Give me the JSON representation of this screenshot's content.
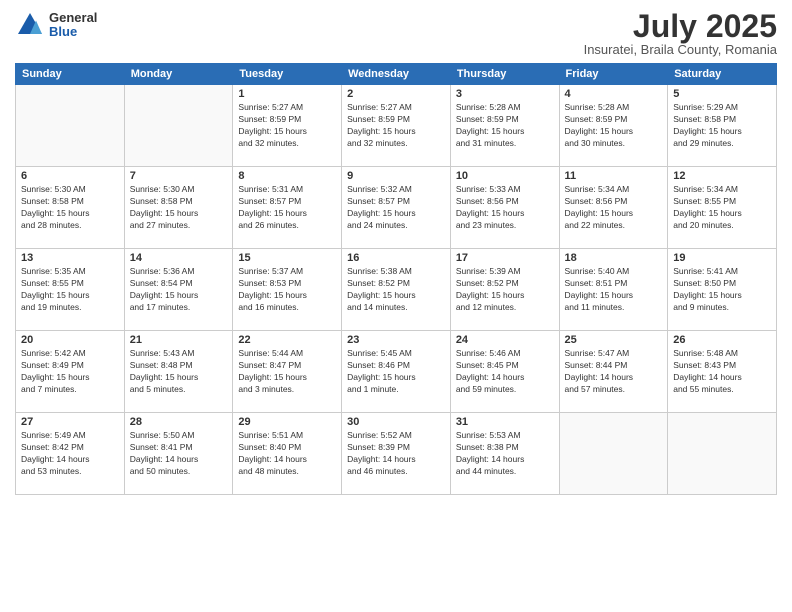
{
  "header": {
    "logo": {
      "general": "General",
      "blue": "Blue"
    },
    "title": "July 2025",
    "location": "Insuratei, Braila County, Romania"
  },
  "calendar": {
    "weekdays": [
      "Sunday",
      "Monday",
      "Tuesday",
      "Wednesday",
      "Thursday",
      "Friday",
      "Saturday"
    ],
    "weeks": [
      [
        {
          "day": "",
          "detail": ""
        },
        {
          "day": "",
          "detail": ""
        },
        {
          "day": "1",
          "detail": "Sunrise: 5:27 AM\nSunset: 8:59 PM\nDaylight: 15 hours\nand 32 minutes."
        },
        {
          "day": "2",
          "detail": "Sunrise: 5:27 AM\nSunset: 8:59 PM\nDaylight: 15 hours\nand 32 minutes."
        },
        {
          "day": "3",
          "detail": "Sunrise: 5:28 AM\nSunset: 8:59 PM\nDaylight: 15 hours\nand 31 minutes."
        },
        {
          "day": "4",
          "detail": "Sunrise: 5:28 AM\nSunset: 8:59 PM\nDaylight: 15 hours\nand 30 minutes."
        },
        {
          "day": "5",
          "detail": "Sunrise: 5:29 AM\nSunset: 8:58 PM\nDaylight: 15 hours\nand 29 minutes."
        }
      ],
      [
        {
          "day": "6",
          "detail": "Sunrise: 5:30 AM\nSunset: 8:58 PM\nDaylight: 15 hours\nand 28 minutes."
        },
        {
          "day": "7",
          "detail": "Sunrise: 5:30 AM\nSunset: 8:58 PM\nDaylight: 15 hours\nand 27 minutes."
        },
        {
          "day": "8",
          "detail": "Sunrise: 5:31 AM\nSunset: 8:57 PM\nDaylight: 15 hours\nand 26 minutes."
        },
        {
          "day": "9",
          "detail": "Sunrise: 5:32 AM\nSunset: 8:57 PM\nDaylight: 15 hours\nand 24 minutes."
        },
        {
          "day": "10",
          "detail": "Sunrise: 5:33 AM\nSunset: 8:56 PM\nDaylight: 15 hours\nand 23 minutes."
        },
        {
          "day": "11",
          "detail": "Sunrise: 5:34 AM\nSunset: 8:56 PM\nDaylight: 15 hours\nand 22 minutes."
        },
        {
          "day": "12",
          "detail": "Sunrise: 5:34 AM\nSunset: 8:55 PM\nDaylight: 15 hours\nand 20 minutes."
        }
      ],
      [
        {
          "day": "13",
          "detail": "Sunrise: 5:35 AM\nSunset: 8:55 PM\nDaylight: 15 hours\nand 19 minutes."
        },
        {
          "day": "14",
          "detail": "Sunrise: 5:36 AM\nSunset: 8:54 PM\nDaylight: 15 hours\nand 17 minutes."
        },
        {
          "day": "15",
          "detail": "Sunrise: 5:37 AM\nSunset: 8:53 PM\nDaylight: 15 hours\nand 16 minutes."
        },
        {
          "day": "16",
          "detail": "Sunrise: 5:38 AM\nSunset: 8:52 PM\nDaylight: 15 hours\nand 14 minutes."
        },
        {
          "day": "17",
          "detail": "Sunrise: 5:39 AM\nSunset: 8:52 PM\nDaylight: 15 hours\nand 12 minutes."
        },
        {
          "day": "18",
          "detail": "Sunrise: 5:40 AM\nSunset: 8:51 PM\nDaylight: 15 hours\nand 11 minutes."
        },
        {
          "day": "19",
          "detail": "Sunrise: 5:41 AM\nSunset: 8:50 PM\nDaylight: 15 hours\nand 9 minutes."
        }
      ],
      [
        {
          "day": "20",
          "detail": "Sunrise: 5:42 AM\nSunset: 8:49 PM\nDaylight: 15 hours\nand 7 minutes."
        },
        {
          "day": "21",
          "detail": "Sunrise: 5:43 AM\nSunset: 8:48 PM\nDaylight: 15 hours\nand 5 minutes."
        },
        {
          "day": "22",
          "detail": "Sunrise: 5:44 AM\nSunset: 8:47 PM\nDaylight: 15 hours\nand 3 minutes."
        },
        {
          "day": "23",
          "detail": "Sunrise: 5:45 AM\nSunset: 8:46 PM\nDaylight: 15 hours\nand 1 minute."
        },
        {
          "day": "24",
          "detail": "Sunrise: 5:46 AM\nSunset: 8:45 PM\nDaylight: 14 hours\nand 59 minutes."
        },
        {
          "day": "25",
          "detail": "Sunrise: 5:47 AM\nSunset: 8:44 PM\nDaylight: 14 hours\nand 57 minutes."
        },
        {
          "day": "26",
          "detail": "Sunrise: 5:48 AM\nSunset: 8:43 PM\nDaylight: 14 hours\nand 55 minutes."
        }
      ],
      [
        {
          "day": "27",
          "detail": "Sunrise: 5:49 AM\nSunset: 8:42 PM\nDaylight: 14 hours\nand 53 minutes."
        },
        {
          "day": "28",
          "detail": "Sunrise: 5:50 AM\nSunset: 8:41 PM\nDaylight: 14 hours\nand 50 minutes."
        },
        {
          "day": "29",
          "detail": "Sunrise: 5:51 AM\nSunset: 8:40 PM\nDaylight: 14 hours\nand 48 minutes."
        },
        {
          "day": "30",
          "detail": "Sunrise: 5:52 AM\nSunset: 8:39 PM\nDaylight: 14 hours\nand 46 minutes."
        },
        {
          "day": "31",
          "detail": "Sunrise: 5:53 AM\nSunset: 8:38 PM\nDaylight: 14 hours\nand 44 minutes."
        },
        {
          "day": "",
          "detail": ""
        },
        {
          "day": "",
          "detail": ""
        }
      ]
    ]
  }
}
